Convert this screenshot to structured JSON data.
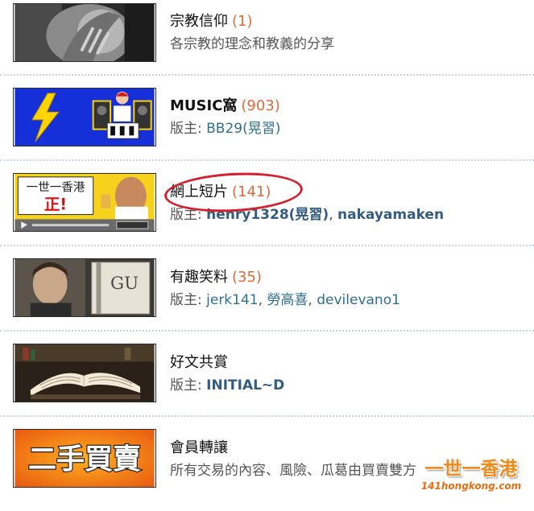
{
  "forums": [
    {
      "title": "宗教信仰",
      "count": "(1)",
      "description": "各宗教的理念和教義的分享",
      "thumbnail_icon": "praying-hands-photo"
    },
    {
      "title": "MUSIC窩",
      "count": "(903)",
      "moderator_label": "版主:",
      "moderators": [
        "BB29(晃習)"
      ],
      "thumbnail_icon": "lightning-dj-banner"
    },
    {
      "title": "網上短片",
      "count": "(141)",
      "moderator_label": "版主:",
      "moderators": [
        "henry1328(晃習)",
        "nakayamaken"
      ],
      "moderator_separator": ",",
      "thumbnail_icon": "video-player-banner",
      "thumbnail_text": {
        "line1": "一世一香港",
        "line2": "正!"
      }
    },
    {
      "title": "有趣笑料",
      "count": "(35)",
      "moderator_label": "版主:",
      "moderators": [
        "jerk141",
        "勞高喜",
        "devilevano1"
      ],
      "moderator_separator": ",",
      "thumbnail_icon": "comedian-photo",
      "thumbnail_text": {
        "letters": "GU"
      }
    },
    {
      "title": "好文共賞",
      "moderator_label": "版主:",
      "moderators": [
        "INITIAL~D"
      ],
      "thumbnail_icon": "open-book-photo"
    },
    {
      "title": "會員轉讓",
      "description": "所有交易的內容、風險、瓜葛由買賣雙方",
      "thumbnail_icon": "second-hand-banner",
      "thumbnail_text": {
        "banner": "二手買賣"
      }
    }
  ],
  "watermark": {
    "main": "一世一香港",
    "url": "141hongkong.com"
  },
  "colors": {
    "count": "#e0693c",
    "moderator_link": "#2f6f92",
    "divider": "#c7d6e6",
    "highlight_circle": "#d61e2c",
    "watermark": "#f08a1a"
  }
}
